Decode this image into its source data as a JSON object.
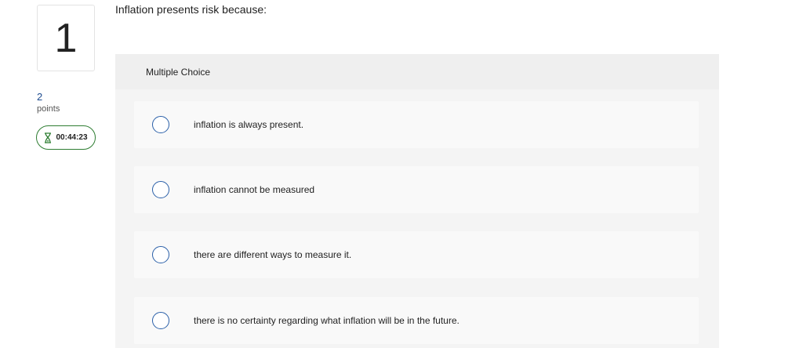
{
  "question": {
    "number": "1",
    "points_value": "2",
    "points_label": "points",
    "timer": "00:44:23",
    "text": "Inflation presents risk because:"
  },
  "panel": {
    "header": "Multiple Choice",
    "options": [
      {
        "label": "inflation is always present."
      },
      {
        "label": "inflation cannot be measured"
      },
      {
        "label": "there are different ways to measure it."
      },
      {
        "label": "there is no certainty regarding what inflation will be in the future."
      }
    ]
  },
  "colors": {
    "accent": "#2a5fa8",
    "timer_border": "#2e7d32",
    "points": "#1d4b8f"
  }
}
